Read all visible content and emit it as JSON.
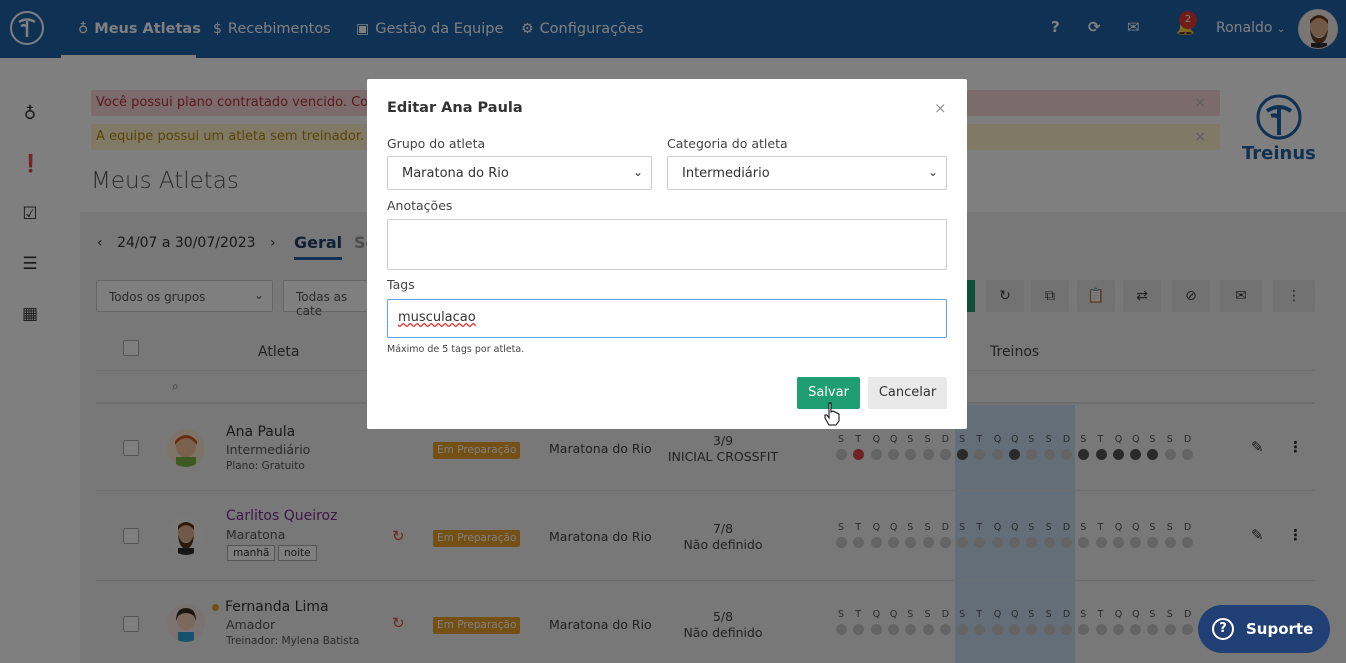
{
  "nav": {
    "items": [
      {
        "label": "Meus Atletas",
        "icon": "medal-icon"
      },
      {
        "label": "Recebimentos",
        "icon": "dollar-icon"
      },
      {
        "label": "Gestão da Equipe",
        "icon": "team-icon"
      },
      {
        "label": "Configurações",
        "icon": "gears-icon"
      }
    ],
    "help": "?",
    "notifications_count": "2",
    "user": "Ronaldo"
  },
  "alerts": {
    "plan_expired": "Você possui plano contratado vencido. Consu",
    "no_coach": "A equipe possui um atleta sem treinador. Clic"
  },
  "page": {
    "title": "Meus Atletas",
    "week": "24/07 a 30/07/2023",
    "tab_general": "Geral",
    "tab_second": "Se",
    "filters": {
      "groups": "Todos os grupos",
      "categories": "Todas as cate"
    }
  },
  "brand": {
    "name": "Treinus"
  },
  "table": {
    "col_athlete": "Atleta",
    "col_trainings": "Treinos",
    "day_letters": [
      "S",
      "T",
      "Q",
      "Q",
      "S",
      "S",
      "D",
      "S",
      "T",
      "Q",
      "Q",
      "S",
      "S",
      "D",
      "S",
      "T",
      "Q",
      "Q",
      "S",
      "S",
      "D"
    ],
    "rows": [
      {
        "name": "Ana Paula",
        "category": "Intermediário",
        "extra": "Plano: Gratuito",
        "status": "Em Preparação",
        "group": "Maratona do Rio",
        "plan_count": "3/9",
        "plan_name": "INICIAL CROSSFIT",
        "dots": [
          "g",
          "r",
          "g",
          "g",
          "g",
          "g",
          "g",
          "d",
          "g",
          "g",
          "d",
          "g",
          "g",
          "g",
          "d",
          "d",
          "d",
          "d",
          "d",
          "g",
          "g"
        ]
      },
      {
        "name": "Carlitos Queiroz",
        "category": "Maratona",
        "tags": [
          "manhã",
          "noite"
        ],
        "status": "Em Preparação",
        "group": "Maratona do Rio",
        "plan_count": "7/8",
        "plan_name": "Não definido",
        "dots": [
          "g",
          "g",
          "g",
          "g",
          "g",
          "g",
          "g",
          "g",
          "g",
          "g",
          "g",
          "g",
          "g",
          "g",
          "g",
          "g",
          "g",
          "g",
          "g",
          "g",
          "g"
        ]
      },
      {
        "name": "Fernanda Lima",
        "category": "Amador",
        "extra": "Treinador: Mylena Batista",
        "status": "Em Preparação",
        "group": "Maratona do Rio",
        "plan_count": "5/8",
        "plan_name": "Não definido",
        "dots": [
          "g",
          "g",
          "g",
          "g",
          "g",
          "g",
          "g",
          "g",
          "g",
          "g",
          "g",
          "g",
          "g",
          "g",
          "g",
          "g",
          "g",
          "g",
          "g",
          "g",
          "g"
        ]
      }
    ]
  },
  "modal": {
    "title": "Editar Ana Paula",
    "group_label": "Grupo do atleta",
    "group_value": "Maratona do Rio",
    "category_label": "Categoria do atleta",
    "category_value": "Intermediário",
    "notes_label": "Anotações",
    "notes_value": "",
    "tags_label": "Tags",
    "tags_value": "musculacao",
    "tags_hint": "Máximo de 5 tags por atleta.",
    "save": "Salvar",
    "cancel": "Cancelar",
    "close": "×"
  },
  "support": {
    "label": "Suporte"
  },
  "colors": {
    "nav": "#1e62a8",
    "primary": "#1f9d73",
    "warning": "#e8a028",
    "support": "#1f3f75"
  }
}
